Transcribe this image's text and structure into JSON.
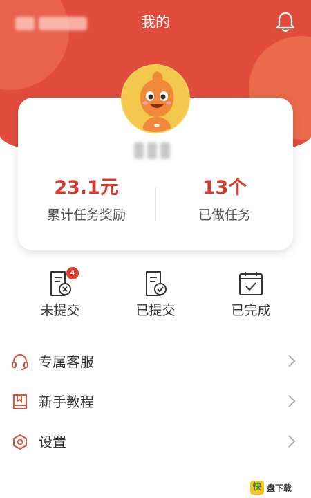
{
  "header": {
    "title": "我的"
  },
  "stats": {
    "reward_value": "23.1元",
    "reward_label": "累计任务奖励",
    "done_value": "13个",
    "done_label": "已做任务"
  },
  "tasks": [
    {
      "label": "未提交",
      "badge": "4",
      "icon": "doc-x-icon"
    },
    {
      "label": "已提交",
      "icon": "doc-check-icon"
    },
    {
      "label": "已完成",
      "icon": "calendar-check-icon"
    }
  ],
  "menu": [
    {
      "label": "专属客服",
      "icon": "headset-icon"
    },
    {
      "label": "新手教程",
      "icon": "book-icon"
    },
    {
      "label": "设置",
      "icon": "settings-hex-icon"
    }
  ],
  "watermark": {
    "logo": "快",
    "text": "盘下载"
  },
  "colors": {
    "brand": "#e24c3d",
    "accent": "#d33a2c",
    "badge": "#e03c2e"
  }
}
